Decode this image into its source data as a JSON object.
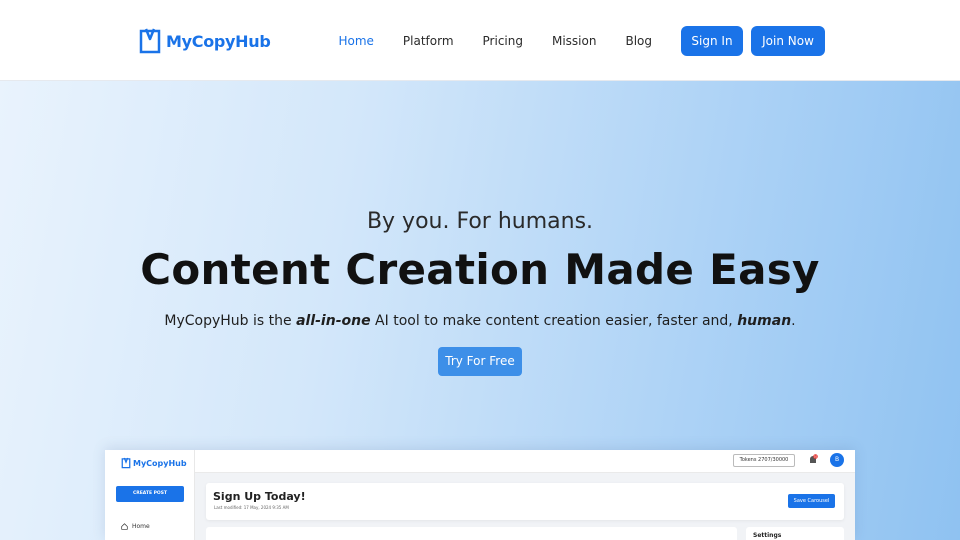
{
  "brand": {
    "name": "MyCopyHub",
    "color": "#1a73e8"
  },
  "nav": {
    "links": [
      {
        "label": "Home",
        "active": true
      },
      {
        "label": "Platform",
        "active": false
      },
      {
        "label": "Pricing",
        "active": false
      },
      {
        "label": "Mission",
        "active": false
      },
      {
        "label": "Blog",
        "active": false
      }
    ],
    "sign_in": "Sign In",
    "join_now": "Join Now"
  },
  "hero": {
    "tagline": "By you. For humans.",
    "headline": "Content Creation Made Easy",
    "sub_pre": "MyCopyHub is the ",
    "sub_em1": "all-in-one",
    "sub_mid": " AI tool to make content creation easier, faster and, ",
    "sub_em2": "human",
    "sub_post": ".",
    "cta": "Try For Free"
  },
  "preview": {
    "logo_text": "MyCopyHub",
    "create_post": "CREATE POST",
    "sidebar_home": "Home",
    "tokens": "Tokens 2707/30000",
    "notification_count": "10",
    "avatar_initial": "B",
    "card_title": "Sign Up Today!",
    "card_meta": "Last modified: 17 May, 2024 9:35 AM",
    "save_button": "Save Carousel",
    "settings_label": "Settings"
  }
}
